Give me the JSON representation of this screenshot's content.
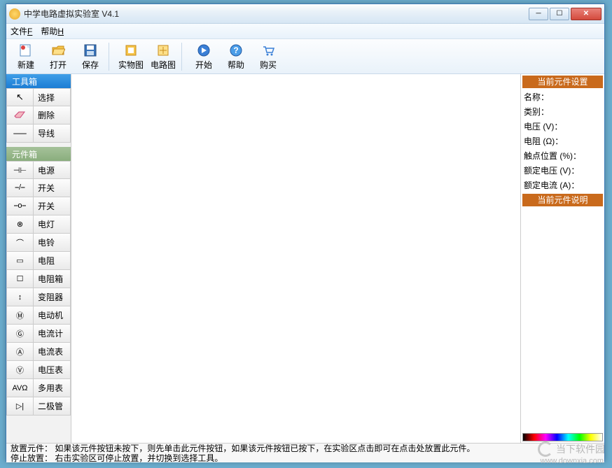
{
  "window": {
    "title": "中学电路虚拟实验室 V4.1"
  },
  "menu": {
    "file": "文件",
    "file_u": "F",
    "help": "帮助",
    "help_u": "H"
  },
  "toolbar": {
    "new": "新建",
    "open": "打开",
    "save": "保存",
    "real": "实物图",
    "circuit": "电路图",
    "start": "开始",
    "helpb": "帮助",
    "buy": "购买"
  },
  "left": {
    "toolbox_hdr": "工具箱",
    "tools": {
      "select": "选择",
      "delete": "删除",
      "wire": "导线"
    },
    "compbox_hdr": "元件箱",
    "components": [
      {
        "sym": "⊣⊢",
        "label": "电源"
      },
      {
        "sym": "⎯/⎯",
        "label": "开关"
      },
      {
        "sym": "⎯o⎯",
        "label": "开关"
      },
      {
        "sym": "⊗",
        "label": "电灯"
      },
      {
        "sym": "⌒",
        "label": "电铃"
      },
      {
        "sym": "▭",
        "label": "电阻"
      },
      {
        "sym": "☐",
        "label": "电阻箱"
      },
      {
        "sym": "↕",
        "label": "变阻器"
      },
      {
        "sym": "Ⓜ",
        "label": "电动机"
      },
      {
        "sym": "Ⓖ",
        "label": "电流计"
      },
      {
        "sym": "Ⓐ",
        "label": "电流表"
      },
      {
        "sym": "Ⓥ",
        "label": "电压表"
      },
      {
        "sym": "AVΩ",
        "label": "多用表"
      },
      {
        "sym": "▷|",
        "label": "二极管"
      }
    ]
  },
  "right": {
    "settings_hdr": "当前元件设置",
    "name": "名称：",
    "category": "类别：",
    "voltage": "电压 (V)：",
    "resistance": "电阻 (Ω)：",
    "contact": "触点位置 (%)：",
    "rated_v": "额定电压 (V)：",
    "rated_a": "额定电流 (A)：",
    "desc_hdr": "当前元件说明"
  },
  "status": {
    "line1": "放置元件：   如果该元件按钮未按下，则先单击此元件按钮，如果该元件按钮已按下，在实验区点击即可在点击处放置此元件。",
    "line2": "停止放置：   右击实验区可停止放置，并切换到选择工具。"
  },
  "watermark": {
    "text": "当下软件园",
    "url": "www.downxia.com"
  }
}
